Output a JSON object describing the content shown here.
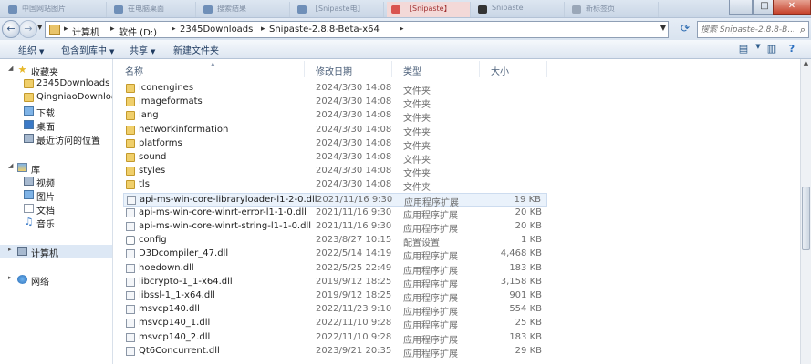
{
  "taskbar": {
    "tabs": [
      {
        "label": "中国网站图片",
        "color": "#6f8fb8"
      },
      {
        "label": "在电脑桌面",
        "color": "#6f8fb8"
      },
      {
        "label": "搜索结果",
        "color": "#6f8fb8"
      },
      {
        "label": "【Snipaste电】",
        "color": "#6f8fb8"
      },
      {
        "label": "【Snipaste】",
        "color": "#d9534f"
      },
      {
        "label": "Snipaste",
        "color": "#333333"
      },
      {
        "label": "新标签页",
        "color": "#9aa7b8"
      }
    ],
    "controls": {
      "minimize": "─",
      "maximize": "□",
      "close": "✕"
    }
  },
  "address": {
    "back_icon": "←",
    "forward_icon": "→",
    "crumbs": [
      "计算机",
      "软件 (D:)",
      "2345Downloads",
      "Snipaste-2.8.8-Beta-x64"
    ],
    "refresh_icon": "⟳",
    "search_placeholder": "搜索 Snipaste-2.8.8-B...",
    "search_icon": "⌕"
  },
  "toolbar": {
    "organize": "组织",
    "include_library": "包含到库中",
    "share": "共享",
    "new_folder": "新建文件夹"
  },
  "sidebar": {
    "favorites": "收藏夹",
    "favorite_items": [
      "2345Downloads",
      "QingniaoDownload",
      "下载",
      "桌面",
      "最近访问的位置"
    ],
    "library": "库",
    "library_items": [
      "视频",
      "图片",
      "文档",
      "音乐"
    ],
    "computer": "计算机",
    "network": "网络"
  },
  "columns": {
    "name": "名称",
    "date": "修改日期",
    "type": "类型",
    "size": "大小"
  },
  "files": [
    {
      "name": "iconengines",
      "date": "2024/3/30 14:08",
      "type": "文件夹",
      "size": "",
      "kind": "folder"
    },
    {
      "name": "imageformats",
      "date": "2024/3/30 14:08",
      "type": "文件夹",
      "size": "",
      "kind": "folder"
    },
    {
      "name": "lang",
      "date": "2024/3/30 14:08",
      "type": "文件夹",
      "size": "",
      "kind": "folder"
    },
    {
      "name": "networkinformation",
      "date": "2024/3/30 14:08",
      "type": "文件夹",
      "size": "",
      "kind": "folder"
    },
    {
      "name": "platforms",
      "date": "2024/3/30 14:08",
      "type": "文件夹",
      "size": "",
      "kind": "folder"
    },
    {
      "name": "sound",
      "date": "2024/3/30 14:08",
      "type": "文件夹",
      "size": "",
      "kind": "folder"
    },
    {
      "name": "styles",
      "date": "2024/3/30 14:08",
      "type": "文件夹",
      "size": "",
      "kind": "folder"
    },
    {
      "name": "tls",
      "date": "2024/3/30 14:08",
      "type": "文件夹",
      "size": "",
      "kind": "folder"
    },
    {
      "name": "api-ms-win-core-libraryloader-l1-2-0.dll",
      "date": "2021/11/16 9:30",
      "type": "应用程序扩展",
      "size": "19 KB",
      "kind": "dll"
    },
    {
      "name": "api-ms-win-core-winrt-error-l1-1-0.dll",
      "date": "2021/11/16 9:30",
      "type": "应用程序扩展",
      "size": "20 KB",
      "kind": "dll"
    },
    {
      "name": "api-ms-win-core-winrt-string-l1-1-0.dll",
      "date": "2021/11/16 9:30",
      "type": "应用程序扩展",
      "size": "20 KB",
      "kind": "dll"
    },
    {
      "name": "config",
      "date": "2023/8/27 10:15",
      "type": "配置设置",
      "size": "1 KB",
      "kind": "cfg"
    },
    {
      "name": "D3Dcompiler_47.dll",
      "date": "2022/5/14 14:19",
      "type": "应用程序扩展",
      "size": "4,468 KB",
      "kind": "dll"
    },
    {
      "name": "hoedown.dll",
      "date": "2022/5/25 22:49",
      "type": "应用程序扩展",
      "size": "183 KB",
      "kind": "dll"
    },
    {
      "name": "libcrypto-1_1-x64.dll",
      "date": "2019/9/12 18:25",
      "type": "应用程序扩展",
      "size": "3,158 KB",
      "kind": "dll"
    },
    {
      "name": "libssl-1_1-x64.dll",
      "date": "2019/9/12 18:25",
      "type": "应用程序扩展",
      "size": "901 KB",
      "kind": "dll"
    },
    {
      "name": "msvcp140.dll",
      "date": "2022/11/23 9:10",
      "type": "应用程序扩展",
      "size": "554 KB",
      "kind": "dll"
    },
    {
      "name": "msvcp140_1.dll",
      "date": "2022/11/10 9:28",
      "type": "应用程序扩展",
      "size": "25 KB",
      "kind": "dll"
    },
    {
      "name": "msvcp140_2.dll",
      "date": "2022/11/10 9:28",
      "type": "应用程序扩展",
      "size": "183 KB",
      "kind": "dll"
    },
    {
      "name": "Qt6Concurrent.dll",
      "date": "2023/9/21 20:35",
      "type": "应用程序扩展",
      "size": "29 KB",
      "kind": "dll"
    }
  ]
}
